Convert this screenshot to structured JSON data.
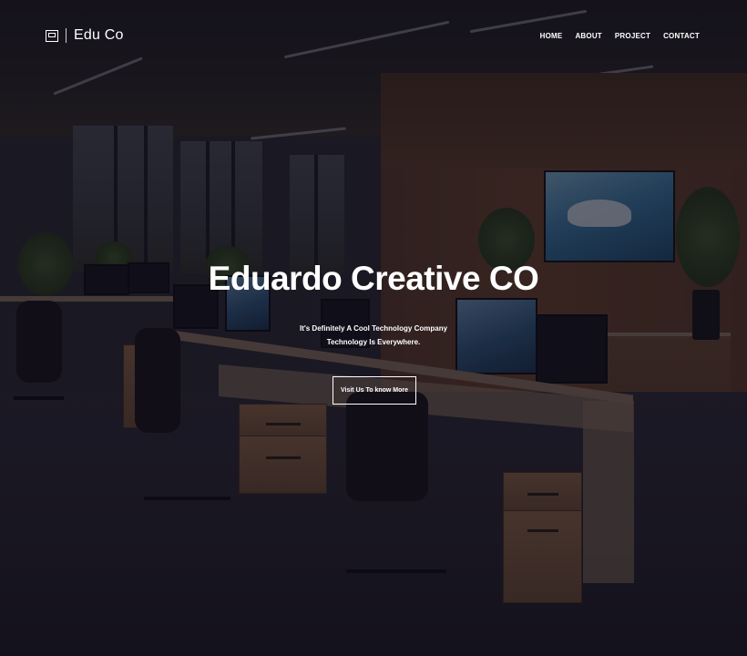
{
  "brand": {
    "icon": "laptop-icon",
    "name": "Edu Co"
  },
  "nav": {
    "items": [
      {
        "label": "HOME"
      },
      {
        "label": "ABOUT"
      },
      {
        "label": "PROJECT"
      },
      {
        "label": "CONTACT"
      }
    ]
  },
  "hero": {
    "title": "Eduardo Creative CO",
    "subtitle_line1": "It's Definitely A Cool Technology Company",
    "subtitle_line2": "Technology Is Everywhere.",
    "cta_label": "Visit Us To know More"
  },
  "colors": {
    "text": "#ffffff",
    "overlay": "#0c0a16"
  },
  "background": {
    "description_icon": "office-photo"
  }
}
